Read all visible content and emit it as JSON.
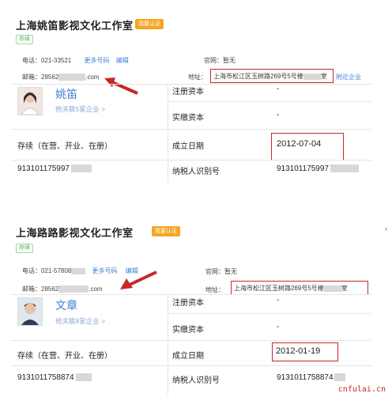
{
  "cards": [
    {
      "title": "上海姚笛影视文化工作室",
      "badge": "我要认证",
      "status": "存续",
      "phone_label": "电话：",
      "phone_value": "021-33521",
      "more_numbers": "更多号码",
      "edit_label": "编辑",
      "email_label": "邮箱：",
      "email_prefix": "28562",
      "email_suffix": ".com",
      "website_label": "官网：",
      "website_value": "暂无",
      "address_label": "地址：",
      "address_value": "上海市松江区玉树路269号5号楼",
      "address_end": "室",
      "nearby_label": "附近企业",
      "person_name": "姚笛",
      "person_link": "他关联5家企业 >",
      "reg_capital_label": "注册资本",
      "reg_capital_value": "-",
      "paid_capital_label": "实缴资本",
      "paid_capital_value": "-",
      "state_label": "存续（在营、开业、在册）",
      "established_label": "成立日期",
      "established_value": "2012-07-04",
      "credit_code": "913101175997",
      "taxpayer_label": "纳税人识别号",
      "taxpayer_value": "913101175997"
    },
    {
      "title": "上海路路影视文化工作室",
      "badge": "我要认证",
      "status": "存续",
      "phone_label": "电话：",
      "phone_value": "021-57808",
      "more_numbers": "更多号码",
      "edit_label": "编辑",
      "email_label": "邮箱：",
      "email_prefix": "28562",
      "email_suffix": ".com",
      "website_label": "官网：",
      "website_value": "暂无",
      "address_label": "地址：",
      "address_value": "上海市松江区玉树路269号5号楼",
      "address_end": "室",
      "person_name": "文章",
      "person_link": "他关联8家企业 >",
      "reg_capital_label": "注册资本",
      "reg_capital_value": "-",
      "paid_capital_label": "实缴资本",
      "paid_capital_value": "-",
      "state_label": "存续（在营、开业、在册）",
      "established_label": "成立日期",
      "established_value": "2012-01-19",
      "credit_code": "9131011758874",
      "taxpayer_label": "纳税人识别号",
      "taxpayer_value": "9131011758874"
    }
  ],
  "watermark": "cnfulai.cn",
  "accent": "#3f7fd6",
  "highlight": "#c62828",
  "badge_color": "#f5a623"
}
